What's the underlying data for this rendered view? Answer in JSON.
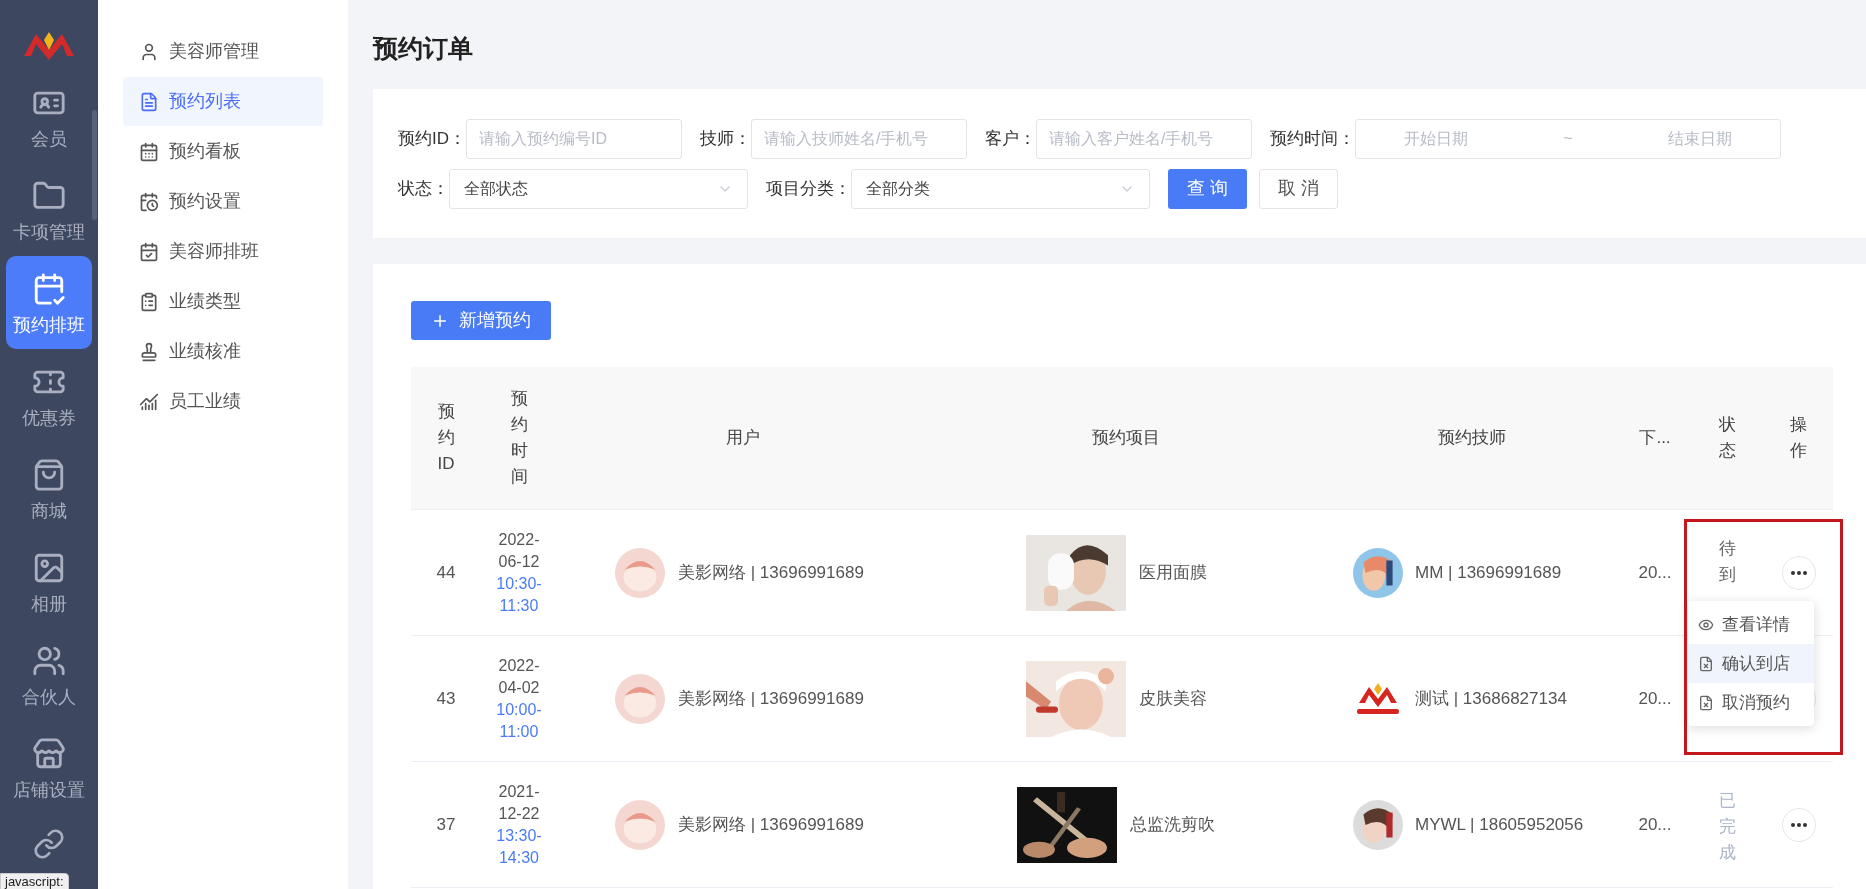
{
  "nav": [
    {
      "label": "会员",
      "selected": false
    },
    {
      "label": "卡项管理",
      "selected": false
    },
    {
      "label": "预约排班",
      "selected": true
    },
    {
      "label": "优惠券",
      "selected": false
    },
    {
      "label": "商城",
      "selected": false
    },
    {
      "label": "相册",
      "selected": false
    },
    {
      "label": "合伙人",
      "selected": false
    },
    {
      "label": "店铺设置",
      "selected": false
    }
  ],
  "subnav": [
    {
      "label": "美容师管理",
      "selected": false
    },
    {
      "label": "预约列表",
      "selected": true
    },
    {
      "label": "预约看板",
      "selected": false
    },
    {
      "label": "预约设置",
      "selected": false
    },
    {
      "label": "美容师排班",
      "selected": false
    },
    {
      "label": "业绩类型",
      "selected": false
    },
    {
      "label": "业绩核准",
      "selected": false
    },
    {
      "label": "员工业绩",
      "selected": false
    }
  ],
  "page_title": "预约订单",
  "filters": {
    "inputs": [
      {
        "label": "预约ID：",
        "placeholder": "请输入预约编号ID"
      },
      {
        "label": "技师：",
        "placeholder": "请输入技师姓名/手机号"
      },
      {
        "label": "客户：",
        "placeholder": "请输入客户姓名/手机号"
      }
    ],
    "date_range": {
      "label": "预约时间：",
      "start_placeholder": "开始日期",
      "separator": "~",
      "end_placeholder": "结束日期"
    },
    "selects": [
      {
        "label": "状态：",
        "value": "全部状态"
      },
      {
        "label": "项目分类：",
        "value": "全部分类"
      }
    ],
    "search_button": "查 询",
    "cancel_button": "取 消"
  },
  "add_button": "新增预约",
  "table": {
    "columns": [
      "预约ID",
      "预约时间",
      "用户",
      "预约项目",
      "预约技师",
      "下...",
      "状态",
      "操作"
    ],
    "rows": [
      {
        "id": "44",
        "date": "2022-06-12",
        "time": "10:30-11:30",
        "user": "美影网络 | 13696991689",
        "project": "医用面膜",
        "technician": "MM | 13696991689",
        "column_6": "20...",
        "status": "待到",
        "faded": false
      },
      {
        "id": "43",
        "date": "2022-04-02",
        "time": "10:00-11:00",
        "user": "美影网络 | 13696991689",
        "project": "皮肤美容",
        "technician": "测试 | 13686827134",
        "column_6": "20..."
      },
      {
        "id": "37",
        "date": "2021-12-22",
        "time": "13:30-14:30",
        "user": "美影网络 | 13696991689",
        "project": "总监洗剪吹",
        "technician": "MYWL | 18605952056",
        "column_6": "20...",
        "status": "已完成",
        "faded": true
      }
    ]
  },
  "action_menu": {
    "items": [
      {
        "label": "查看详情",
        "selected": false
      },
      {
        "label": "确认到店",
        "selected": true
      },
      {
        "label": "取消预约",
        "selected": false
      }
    ]
  },
  "status_tooltip": "javascript:"
}
